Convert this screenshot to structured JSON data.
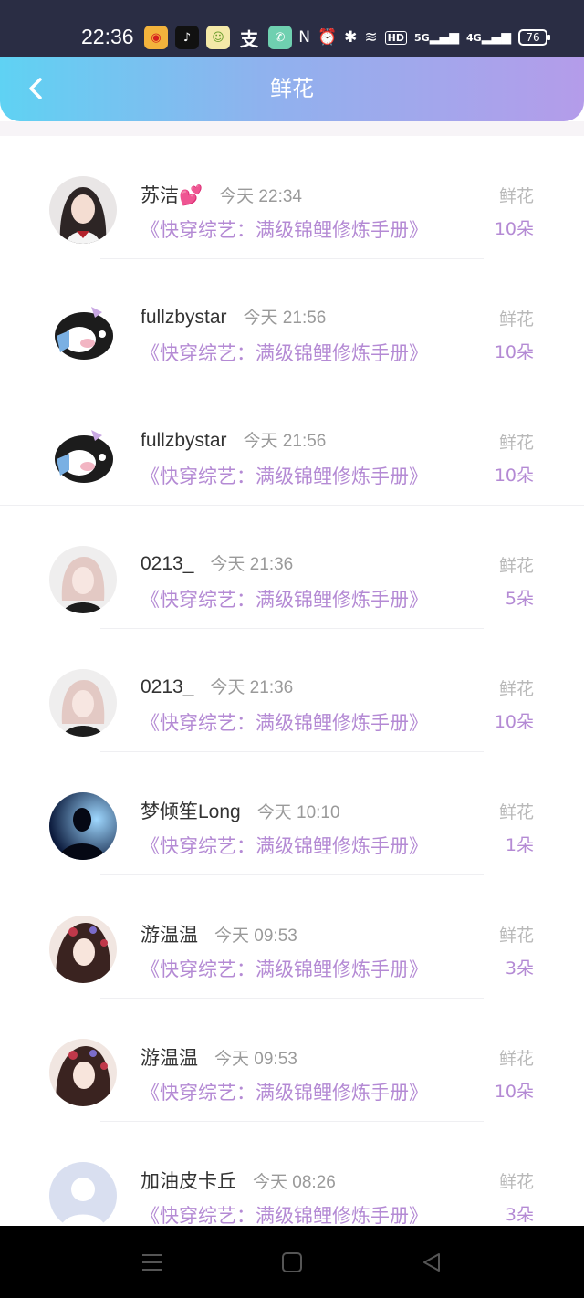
{
  "status_bar": {
    "time": "22:36",
    "hd_label": "HD",
    "net_5g": "5G",
    "net_4g": "4G",
    "battery": "76"
  },
  "header": {
    "title": "鲜花",
    "back_icon": "chevron-left-icon"
  },
  "gift_label": "鲜花",
  "records": [
    {
      "name": "苏洁💕",
      "time": "今天 22:34",
      "book": "《快穿综艺：满级锦鲤修炼手册》",
      "count": "10朵",
      "avatar": "anime-girl-dark-hair"
    },
    {
      "name": "fullzbystar",
      "time": "今天 21:56",
      "book": "《快穿综艺：满级锦鲤修炼手册》",
      "count": "10朵",
      "avatar": "cartoon-cow"
    },
    {
      "name": "fullzbystar",
      "time": "今天 21:56",
      "book": "《快穿综艺：满级锦鲤修炼手册》",
      "count": "10朵",
      "avatar": "cartoon-cow"
    },
    {
      "name": "0213_",
      "time": "今天 21:36",
      "book": "《快穿综艺：满级锦鲤修炼手册》",
      "count": "5朵",
      "avatar": "anime-girl-pink-hair"
    },
    {
      "name": "0213_",
      "time": "今天 21:36",
      "book": "《快穿综艺：满级锦鲤修炼手册》",
      "count": "10朵",
      "avatar": "anime-girl-pink-hair"
    },
    {
      "name": "梦倾笙Long",
      "time": "今天 10:10",
      "book": "《快穿综艺：满级锦鲤修炼手册》",
      "count": "1朵",
      "avatar": "silhouette-blue"
    },
    {
      "name": "游温温",
      "time": "今天 09:53",
      "book": "《快穿综艺：满级锦鲤修炼手册》",
      "count": "3朵",
      "avatar": "anime-girl-flowers"
    },
    {
      "name": "游温温",
      "time": "今天 09:53",
      "book": "《快穿综艺：满级锦鲤修炼手册》",
      "count": "10朵",
      "avatar": "anime-girl-flowers"
    },
    {
      "name": "加油皮卡丘",
      "time": "今天 08:26",
      "book": "《快穿综艺：满级锦鲤修炼手册》",
      "count": "3朵",
      "avatar": "default-avatar"
    }
  ],
  "nav": {
    "menu_icon": "menu-icon",
    "home_icon": "home-square-icon",
    "back_icon": "back-triangle-icon"
  },
  "colors": {
    "header_gradient": [
      "#5fd2f3",
      "#b49cea"
    ],
    "accent_purple": "#b48ad4",
    "label_gray": "#b9b9b9"
  }
}
